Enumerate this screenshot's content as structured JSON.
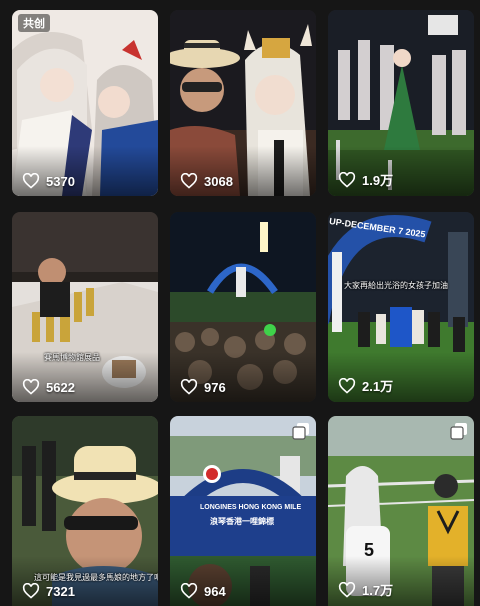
{
  "tiles": [
    {
      "likes": "5370",
      "badge": "共创"
    },
    {
      "likes": "3068"
    },
    {
      "likes": "1.9万"
    },
    {
      "likes": "5622",
      "caption": "賽馬博物館展品"
    },
    {
      "likes": "976"
    },
    {
      "likes": "2.1万",
      "caption": "大家再給出光浴的女孩子加油",
      "sign": "UP-DECEMBER 7 2025"
    },
    {
      "likes": "7321",
      "caption": "這可能是我見過最多馬娘的地方了吧"
    },
    {
      "likes": "964",
      "sign_top": "LONGINES HONG KONG MILE",
      "sign_bottom": "浪琴香港一哩錦標"
    },
    {
      "likes": "1.7万",
      "bib": "5"
    }
  ],
  "icons": {
    "like": "heart-outline-icon",
    "multi": "multiple-images-icon"
  }
}
